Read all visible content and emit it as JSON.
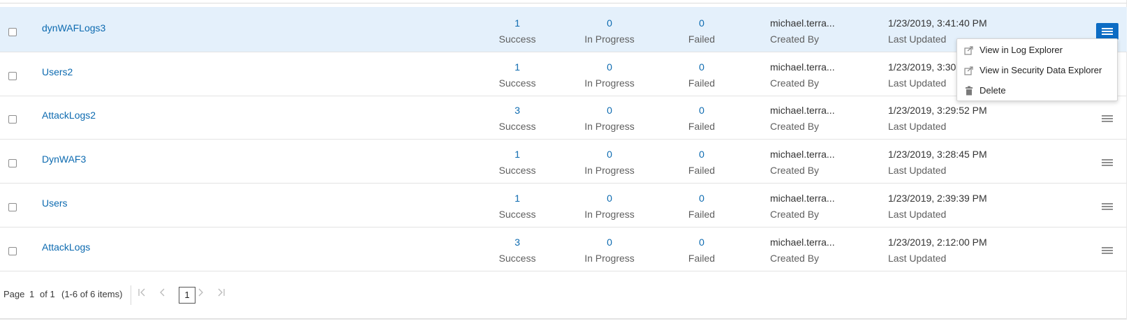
{
  "rows": [
    {
      "name": "dynWAFLogs3",
      "success": "1",
      "in_progress": "0",
      "failed": "0",
      "owner": "michael.terra...",
      "updated": "1/23/2019, 3:41:40 PM"
    },
    {
      "name": "Users2",
      "success": "1",
      "in_progress": "0",
      "failed": "0",
      "owner": "michael.terra...",
      "updated": "1/23/2019, 3:30"
    },
    {
      "name": "AttackLogs2",
      "success": "3",
      "in_progress": "0",
      "failed": "0",
      "owner": "michael.terra...",
      "updated": "1/23/2019, 3:29:52 PM"
    },
    {
      "name": "DynWAF3",
      "success": "1",
      "in_progress": "0",
      "failed": "0",
      "owner": "michael.terra...",
      "updated": "1/23/2019, 3:28:45 PM"
    },
    {
      "name": "Users",
      "success": "1",
      "in_progress": "0",
      "failed": "0",
      "owner": "michael.terra...",
      "updated": "1/23/2019, 2:39:39 PM"
    },
    {
      "name": "AttackLogs",
      "success": "3",
      "in_progress": "0",
      "failed": "0",
      "owner": "michael.terra...",
      "updated": "1/23/2019, 2:12:00 PM"
    }
  ],
  "labels": {
    "success": "Success",
    "in_progress": "In Progress",
    "failed": "Failed",
    "created_by": "Created By",
    "last_updated": "Last Updated"
  },
  "context_menu": {
    "items": [
      {
        "label": "View in Log Explorer",
        "icon": "external-link-icon"
      },
      {
        "label": "View in Security Data Explorer",
        "icon": "external-link-icon"
      },
      {
        "label": "Delete",
        "icon": "trash-icon"
      }
    ]
  },
  "pagination": {
    "page_label": "Page",
    "current_page": "1",
    "of_label": "of 1",
    "items_summary": "(1-6 of 6 items)",
    "page_button": "1"
  },
  "colors": {
    "link": "#0c6ab0",
    "selected_row": "#e4f0fb",
    "menu_button_active": "#0c6cc4"
  }
}
